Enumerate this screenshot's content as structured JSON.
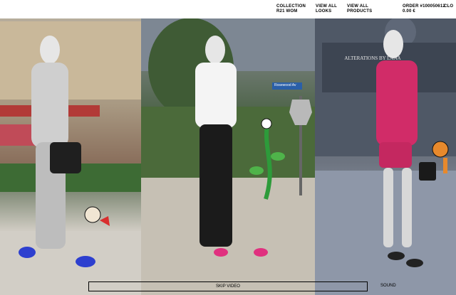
{
  "header": {
    "collection": {
      "line1": "COLLECTION",
      "line2": "R21 WOM"
    },
    "view_looks": {
      "line1": "VIEW ALL",
      "line2": "LOOKS"
    },
    "view_products": {
      "line1": "VIEW ALL",
      "line2": "PRODUCTS"
    },
    "order": {
      "line1": "ORDER #100050612",
      "line2": "0.00 €"
    },
    "close_label": "CLO"
  },
  "video": {
    "skip_label": "SKIP VIDEO",
    "sound_label": "SOUND"
  },
  "looks": [
    {
      "sign_text": "ALTERATIONS BY LANA"
    },
    {
      "street_sign": "Rosewood Av"
    }
  ],
  "colors": {
    "header_bg": "#ffffff",
    "text": "#000000"
  }
}
